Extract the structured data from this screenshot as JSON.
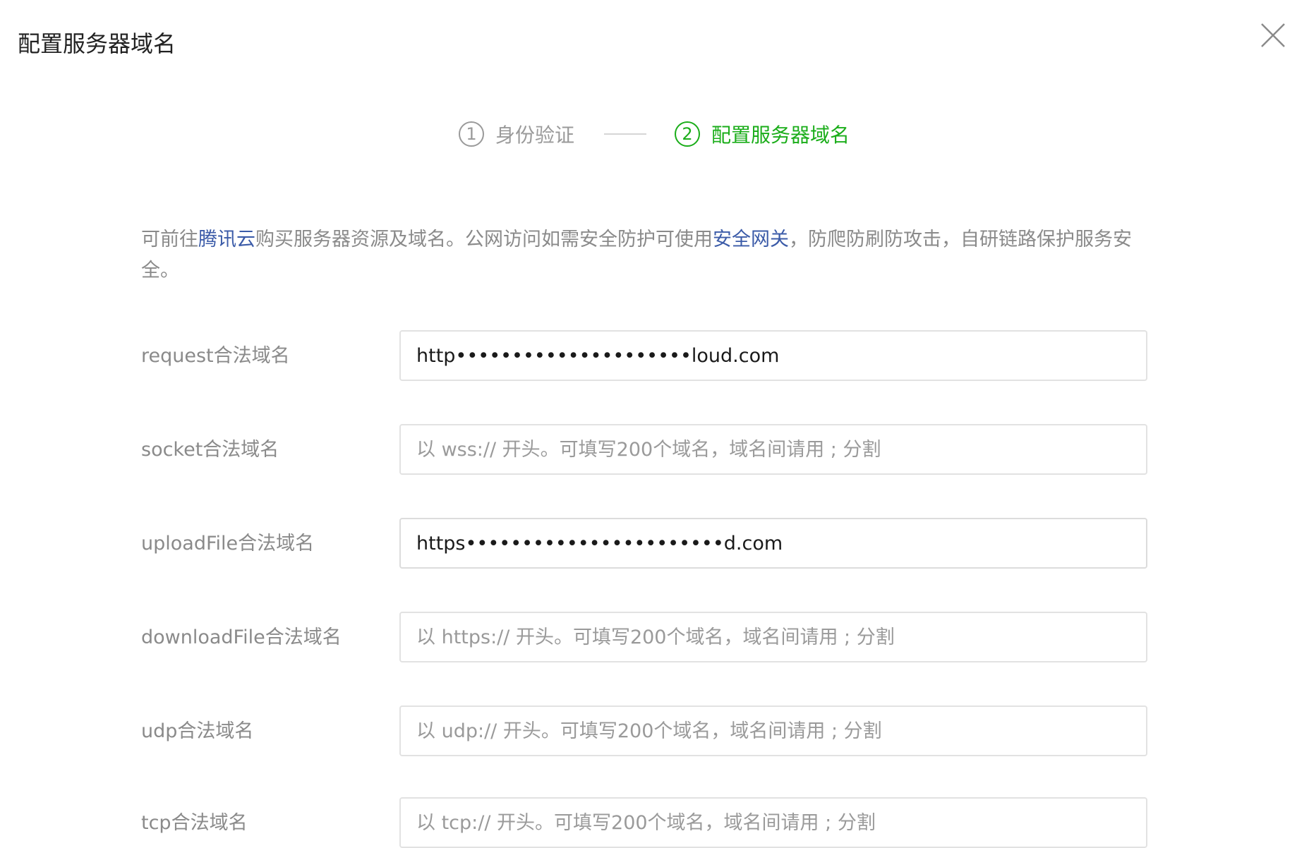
{
  "dialog": {
    "title": "配置服务器域名"
  },
  "stepper": {
    "steps": [
      {
        "number": "1",
        "label": "身份验证",
        "active": false
      },
      {
        "number": "2",
        "label": "配置服务器域名",
        "active": true
      }
    ]
  },
  "description": {
    "part1": "可前往",
    "link1": "腾讯云",
    "part2": "购买服务器资源及域名。公网访问如需安全防护可使用",
    "link2": "安全网关",
    "part3": "，防爬防刷防攻击，自研链路保护服务安全。"
  },
  "form": {
    "fields": [
      {
        "label": "request合法域名",
        "value": "http•••••••••••••••••••••loud.com",
        "placeholder": ""
      },
      {
        "label": "socket合法域名",
        "value": "",
        "placeholder": "以 wss:// 开头。可填写200个域名，域名间请用 ; 分割"
      },
      {
        "label": "uploadFile合法域名",
        "value": "https•••••••••••••••••••••••d.com",
        "placeholder": ""
      },
      {
        "label": "downloadFile合法域名",
        "value": "",
        "placeholder": "以 https:// 开头。可填写200个域名，域名间请用 ; 分割"
      },
      {
        "label": "udp合法域名",
        "value": "",
        "placeholder": "以 udp:// 开头。可填写200个域名，域名间请用 ; 分割"
      },
      {
        "label": "tcp合法域名",
        "value": "",
        "placeholder": "以 tcp:// 开头。可填写200个域名，域名间请用 ; 分割"
      }
    ]
  },
  "colors": {
    "active_step": "#1aad19",
    "link": "#3b5ba8",
    "muted_text": "#8a8a8a"
  }
}
